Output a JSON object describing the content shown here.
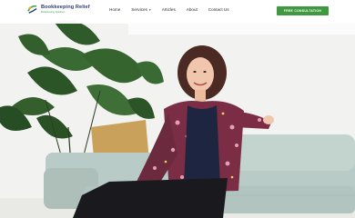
{
  "brand": {
    "name": "Bookkeeping Relief",
    "tagline": "Bookkeeping Solutions",
    "accent": "#3f9a3f",
    "primary": "#2b3c78"
  },
  "nav": {
    "items": [
      {
        "label": "Home"
      },
      {
        "label": "Services"
      },
      {
        "label": "Articles"
      },
      {
        "label": "About"
      },
      {
        "label": "Contact Us"
      }
    ]
  },
  "cta": {
    "label": "FREE CONSULTATION"
  },
  "hero": {
    "image": "woman-on-sofa-photo",
    "icons": {
      "services_dropdown": "chevron-down-icon"
    }
  }
}
